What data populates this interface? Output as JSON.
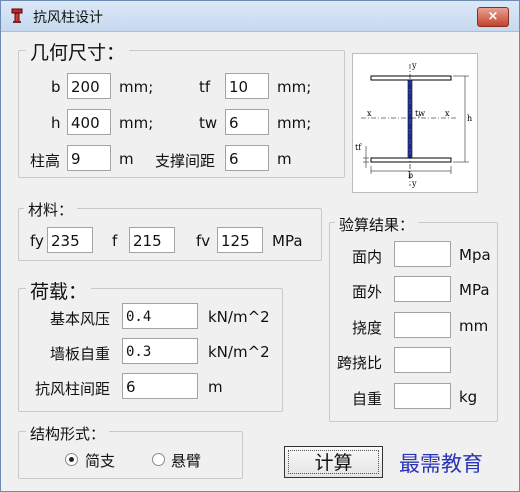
{
  "window": {
    "title": "抗风柱设计",
    "close_glyph": "×"
  },
  "geometry": {
    "legend": "几何尺寸：",
    "b_label": "b",
    "b_value": "200",
    "b_unit": "mm;",
    "tf_label": "tf",
    "tf_value": "10",
    "tf_unit": "mm;",
    "h_label": "h",
    "h_value": "400",
    "h_unit": "mm;",
    "tw_label": "tw",
    "tw_value": "6",
    "tw_unit": "mm;",
    "height_label": "柱高",
    "height_value": "9",
    "height_unit": "m",
    "support_label": "支撑间距",
    "support_value": "6",
    "support_unit": "m"
  },
  "diagram_labels": {
    "y": "y",
    "x": "x",
    "tw": "tw",
    "tf": "tf",
    "b": "b",
    "h": "h"
  },
  "material": {
    "legend": "材料：",
    "fy_label": "fy",
    "fy_value": "235",
    "f_label": "f",
    "f_value": "215",
    "fv_label": "fv",
    "fv_value": "125",
    "unit": "MPa"
  },
  "load": {
    "legend": "荷载：",
    "wind_label": "基本风压",
    "wind_value": "0.4",
    "wind_unit": "kN/m^2",
    "wall_label": "墙板自重",
    "wall_value": "0.3",
    "wall_unit": "kN/m^2",
    "spacing_label": "抗风柱间距",
    "spacing_value": "6",
    "spacing_unit": "m"
  },
  "results": {
    "legend": "验算结果：",
    "in_plane_label": "面内",
    "in_plane_unit": "Mpa",
    "out_plane_label": "面外",
    "out_plane_unit": "MPa",
    "deflection_label": "挠度",
    "deflection_unit": "mm",
    "span_ratio_label": "跨挠比",
    "self_weight_label": "自重",
    "self_weight_unit": "kg"
  },
  "structure": {
    "legend": "结构形式：",
    "option_simple": "简支",
    "option_cantilever": "悬臂",
    "selected": "简支"
  },
  "calc_button": "计算",
  "watermark": "最需教育"
}
